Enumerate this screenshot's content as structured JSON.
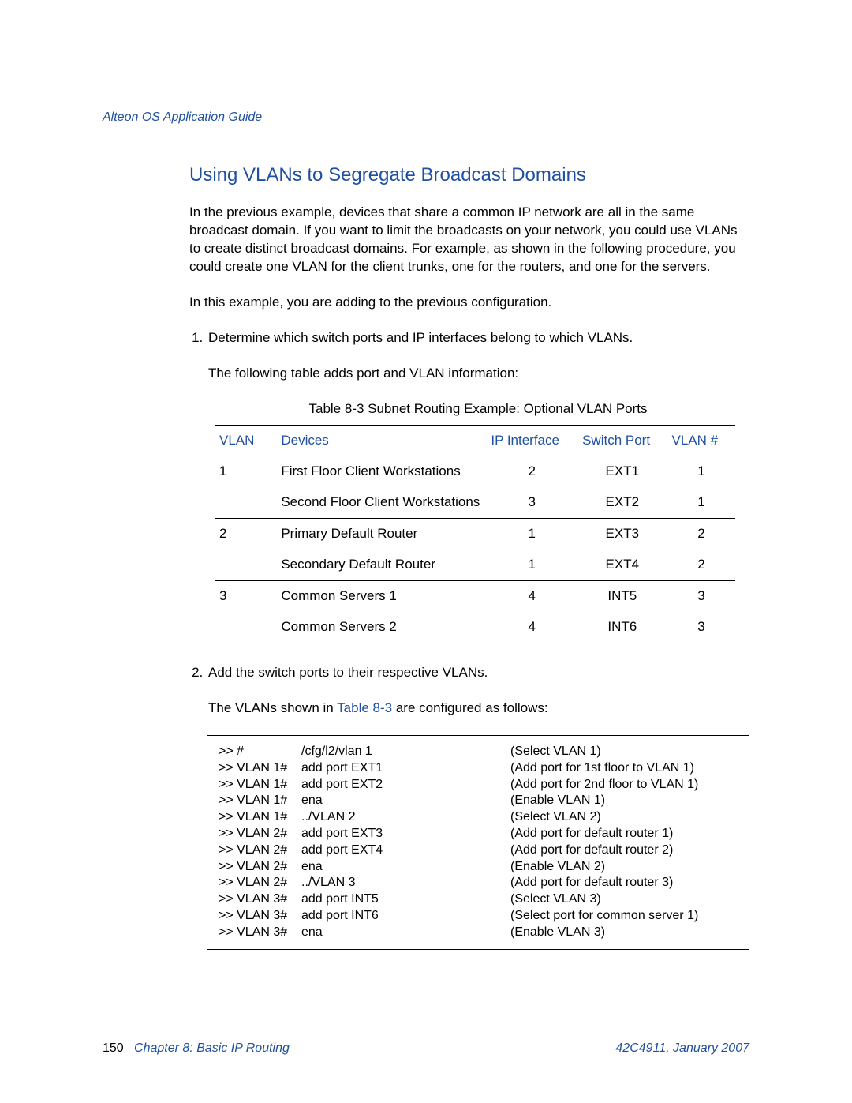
{
  "header": {
    "title": "Alteon OS Application Guide"
  },
  "section": {
    "heading": "Using VLANs to Segregate Broadcast Domains",
    "para1": "In the previous example, devices that share a common IP network are all in the same broadcast domain. If you want to limit the broadcasts on your network, you could use VLANs to create distinct broadcast domains. For example, as shown in the following procedure, you could create one VLAN for the client trunks, one for the routers, and one for the servers.",
    "para2": "In this example, you are adding to the previous configuration."
  },
  "step1": {
    "title": "Determine which switch ports and IP interfaces belong to which VLANs.",
    "intro": "The following table adds port and VLAN information:"
  },
  "table_caption": "Table 8-3  Subnet Routing Example: Optional VLAN Ports",
  "table_headers": {
    "vlan": "VLAN",
    "devices": "Devices",
    "ip": "IP Interface",
    "port": "Switch Port",
    "num": "VLAN #"
  },
  "table_rows": [
    {
      "vlan": "1",
      "devices": "First Floor Client Workstations",
      "ip": "2",
      "port": "EXT1",
      "num": "1",
      "sep": true
    },
    {
      "vlan": "",
      "devices": "Second Floor Client Workstations",
      "ip": "3",
      "port": "EXT2",
      "num": "1",
      "sep": false
    },
    {
      "vlan": "2",
      "devices": "Primary Default Router",
      "ip": "1",
      "port": "EXT3",
      "num": "2",
      "sep": true
    },
    {
      "vlan": "",
      "devices": "Secondary Default Router",
      "ip": "1",
      "port": "EXT4",
      "num": "2",
      "sep": false
    },
    {
      "vlan": "3",
      "devices": "Common Servers 1",
      "ip": "4",
      "port": "INT5",
      "num": "3",
      "sep": true
    },
    {
      "vlan": "",
      "devices": "Common Servers 2",
      "ip": "4",
      "port": "INT6",
      "num": "3",
      "sep": false
    }
  ],
  "step2": {
    "title": "Add the switch ports to their respective VLANs.",
    "intro_pre": "The VLANs shown in ",
    "intro_link": "Table 8-3",
    "intro_post": " are configured as follows:"
  },
  "cfg": [
    {
      "prompt": ">> #",
      "cmd": "/cfg/l2/vlan 1",
      "desc": "(Select VLAN 1)"
    },
    {
      "prompt": ">> VLAN 1#",
      "cmd": "add port EXT1",
      "desc": "(Add port for 1st floor to VLAN 1)"
    },
    {
      "prompt": ">> VLAN 1#",
      "cmd": "add port EXT2",
      "desc": "(Add port for 2nd floor to VLAN 1)"
    },
    {
      "prompt": ">> VLAN 1#",
      "cmd": "ena",
      "desc": "(Enable VLAN 1)"
    },
    {
      "prompt": ">> VLAN 1#",
      "cmd": "../VLAN 2",
      "desc": "(Select VLAN 2)"
    },
    {
      "prompt": ">> VLAN 2#",
      "cmd": "add port EXT3",
      "desc": "(Add port for default router 1)"
    },
    {
      "prompt": ">> VLAN 2#",
      "cmd": "add port EXT4",
      "desc": "(Add port for default router 2)"
    },
    {
      "prompt": ">> VLAN 2#",
      "cmd": "ena",
      "desc": "(Enable VLAN 2)"
    },
    {
      "prompt": ">> VLAN 2#",
      "cmd": "../VLAN 3",
      "desc": "(Add port for default router 3)"
    },
    {
      "prompt": ">> VLAN 3#",
      "cmd": "add port INT5",
      "desc": "(Select VLAN 3)"
    },
    {
      "prompt": ">> VLAN 3#",
      "cmd": "add port INT6",
      "desc": "(Select port for common server 1)"
    },
    {
      "prompt": ">> VLAN 3#",
      "cmd": "ena",
      "desc": "(Enable VLAN 3)"
    }
  ],
  "footer": {
    "page": "150",
    "chapter": "Chapter 8: Basic IP Routing",
    "docid": "42C4911, January 2007"
  }
}
